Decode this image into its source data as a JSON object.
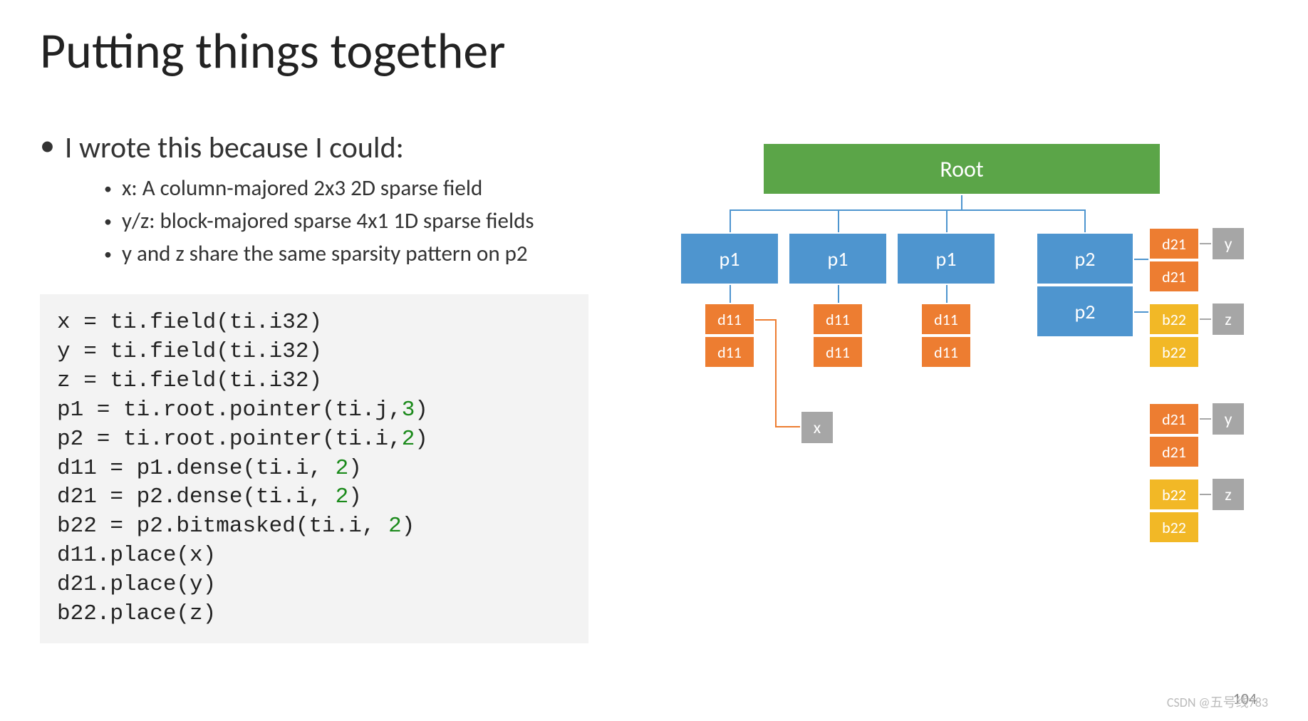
{
  "title": "Putting things together",
  "bullet": "I wrote this because I could:",
  "subs": [
    "x: A column-majored 2x3 2D sparse field",
    "y/z: block-majored sparse 4x1 1D sparse fields",
    "y and z share the same sparsity pattern on p2"
  ],
  "code": {
    "l1a": "x = ti.field(ti.i32)",
    "l2a": "y = ti.field(ti.i32)",
    "l3a": "z = ti.field(ti.i32)",
    "l4a": "p1 = ti.root.pointer(ti.j,",
    "l4n": "3",
    "l4b": ")",
    "l5a": "p2 = ti.root.pointer(ti.i,",
    "l5n": "2",
    "l5b": ")",
    "l6a": "d11 = p1.dense(ti.i, ",
    "l6n": "2",
    "l6b": ")",
    "l7a": "d21 = p2.dense(ti.i, ",
    "l7n": "2",
    "l7b": ")",
    "l8a": "b22 = p2.bitmasked(ti.i, ",
    "l8n": "2",
    "l8b": ")",
    "l9a": "d11.place(x)",
    "l10a": "d21.place(y)",
    "l11a": "b22.place(z)"
  },
  "diagram": {
    "root": "Root",
    "p1": "p1",
    "p2": "p2",
    "d11": "d11",
    "d21": "d21",
    "b22": "b22",
    "x": "x",
    "y": "y",
    "z": "z"
  },
  "page": "104",
  "watermark": "CSDN @五号线783"
}
